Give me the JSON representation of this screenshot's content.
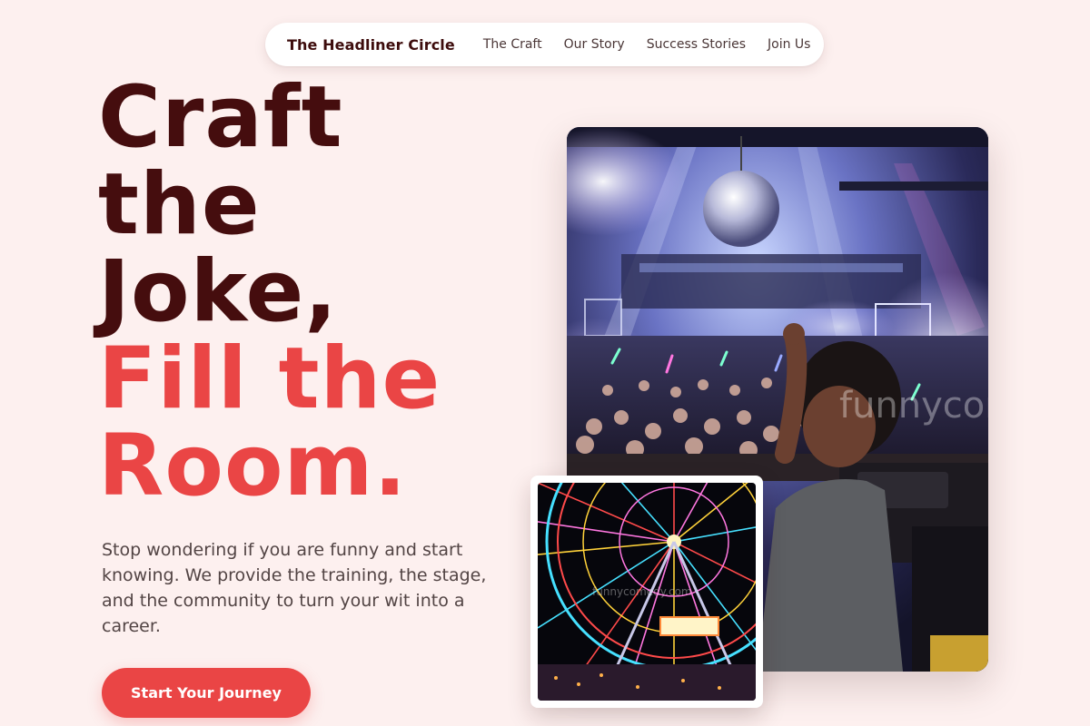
{
  "nav": {
    "brand": "The Headliner Circle",
    "links": [
      "The Craft",
      "Our Story",
      "Success Stories",
      "Join Us"
    ]
  },
  "hero": {
    "headline_dark": [
      "Craft",
      "the",
      "Joke,"
    ],
    "headline_accent": [
      "Fill the",
      "Room."
    ],
    "subtext": "Stop wondering if you are funny and start knowing. We provide the training, the stage, and the community to turn your wit into a career.",
    "cta_label": "Start Your Journey"
  },
  "images": {
    "main_watermark": "funnycomedy.com",
    "small_watermark": "funnycomedy.com"
  },
  "colors": {
    "background": "#fdf0ef",
    "dark": "#450d0e",
    "accent": "#ea4545"
  }
}
